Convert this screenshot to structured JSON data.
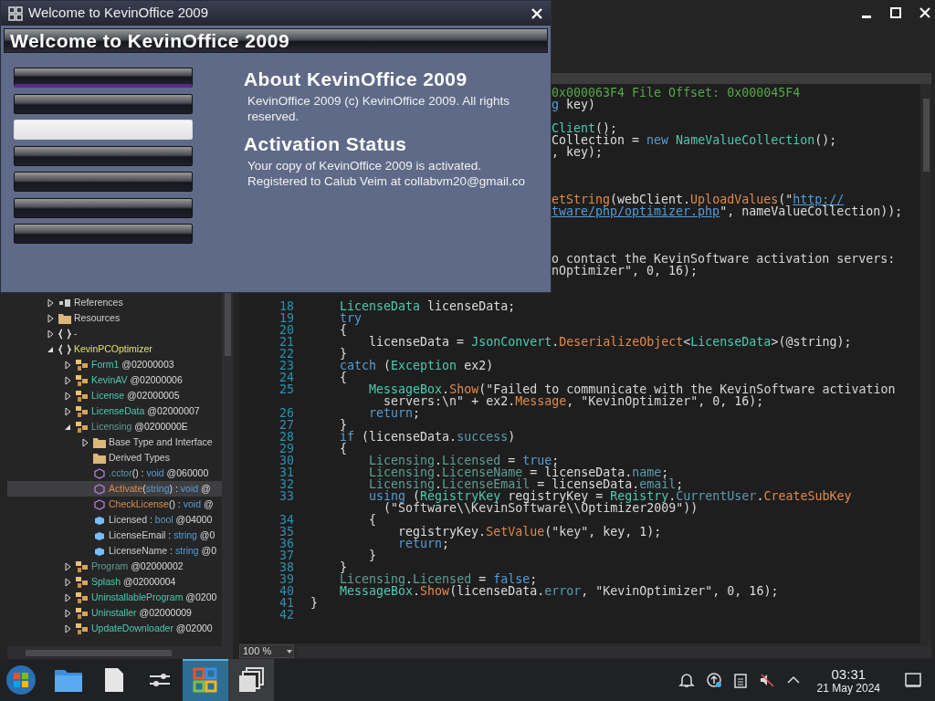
{
  "dialog": {
    "title": "Welcome to KevinOffice 2009",
    "banner": "Welcome to KevinOffice 2009",
    "menu_buttons": [
      {
        "selected": false,
        "focused": true
      },
      {
        "selected": false,
        "focused": false
      },
      {
        "selected": true,
        "focused": false
      },
      {
        "selected": false,
        "focused": false
      },
      {
        "selected": false,
        "focused": false
      },
      {
        "selected": false,
        "focused": false
      },
      {
        "selected": false,
        "focused": false
      }
    ],
    "sections": [
      {
        "heading": "About KevinOffice 2009",
        "lines": [
          "KevinOffice 2009 (c) KevinOffice 2009. All rights",
          "reserved."
        ]
      },
      {
        "heading": "Activation Status",
        "lines": [
          "Your copy of KevinOffice 2009 is activated.",
          "Registered to Calub Veim at collabvm20@gmail.co"
        ]
      }
    ]
  },
  "tree": [
    {
      "kind": "references",
      "expanded": false,
      "selected": false,
      "label": [
        {
          "kind": "field",
          "text": "References"
        }
      ]
    },
    {
      "kind": "folder",
      "expanded": false,
      "selected": false,
      "label": [
        {
          "kind": "field",
          "text": "Resources"
        }
      ]
    },
    {
      "kind": "namespace",
      "expanded": false,
      "selected": false,
      "label": [
        {
          "kind": "field",
          "text": "-"
        }
      ]
    },
    {
      "kind": "namespace",
      "expanded": true,
      "selected": false,
      "label": [
        {
          "kind": "ns",
          "text": "KevinPCOptimizer"
        }
      ],
      "children": [
        {
          "kind": "class",
          "expanded": false,
          "selected": false,
          "label": [
            {
              "kind": "type",
              "text": "Form1"
            },
            {
              "kind": "plain",
              "text": " @02000003"
            }
          ]
        },
        {
          "kind": "class",
          "expanded": false,
          "selected": false,
          "label": [
            {
              "kind": "type",
              "text": "KevinAV"
            },
            {
              "kind": "plain",
              "text": " @02000006"
            }
          ]
        },
        {
          "kind": "class",
          "expanded": false,
          "selected": false,
          "label": [
            {
              "kind": "type",
              "text": "License"
            },
            {
              "kind": "plain",
              "text": " @02000005"
            }
          ]
        },
        {
          "kind": "class",
          "expanded": false,
          "selected": false,
          "label": [
            {
              "kind": "type",
              "text": "LicenseData"
            },
            {
              "kind": "plain",
              "text": " @02000007"
            }
          ]
        },
        {
          "kind": "class",
          "expanded": true,
          "selected": false,
          "label": [
            {
              "kind": "type2",
              "text": "Licensing"
            },
            {
              "kind": "plain",
              "text": " @0200000E"
            }
          ],
          "children": [
            {
              "kind": "folder",
              "expanded": false,
              "selected": false,
              "label": [
                {
                  "kind": "field",
                  "text": "Base Type and Interface"
                }
              ]
            },
            {
              "kind": "folder",
              "selected": false,
              "label": [
                {
                  "kind": "field",
                  "text": "Derived Types"
                }
              ]
            },
            {
              "kind": "method",
              "selected": false,
              "label": [
                {
                  "kind": "prop",
                  "text": ".cctor"
                },
                {
                  "kind": "plain",
                  "text": "() : "
                },
                {
                  "kind": "keyword",
                  "text": "void"
                },
                {
                  "kind": "plain",
                  "text": " @060000"
                }
              ]
            },
            {
              "kind": "method",
              "selected": true,
              "label": [
                {
                  "kind": "method",
                  "text": "Activate"
                },
                {
                  "kind": "plain",
                  "text": "("
                },
                {
                  "kind": "keyword",
                  "text": "string"
                },
                {
                  "kind": "plain",
                  "text": ") : "
                },
                {
                  "kind": "keyword",
                  "text": "void"
                },
                {
                  "kind": "plain",
                  "text": " @"
                }
              ]
            },
            {
              "kind": "method",
              "selected": false,
              "label": [
                {
                  "kind": "method",
                  "text": "CheckLicense"
                },
                {
                  "kind": "plain",
                  "text": "() : "
                },
                {
                  "kind": "keyword",
                  "text": "void"
                },
                {
                  "kind": "plain",
                  "text": " @"
                }
              ]
            },
            {
              "kind": "field",
              "selected": false,
              "label": [
                {
                  "kind": "field",
                  "text": "Licensed"
                },
                {
                  "kind": "plain",
                  "text": " : "
                },
                {
                  "kind": "keyword",
                  "text": "bool"
                },
                {
                  "kind": "plain",
                  "text": " @04000"
                }
              ]
            },
            {
              "kind": "field",
              "selected": false,
              "label": [
                {
                  "kind": "field",
                  "text": "LicenseEmail"
                },
                {
                  "kind": "plain",
                  "text": " : "
                },
                {
                  "kind": "keyword",
                  "text": "string"
                },
                {
                  "kind": "plain",
                  "text": " @0"
                }
              ]
            },
            {
              "kind": "field",
              "selected": false,
              "label": [
                {
                  "kind": "field",
                  "text": "LicenseName"
                },
                {
                  "kind": "plain",
                  "text": " : "
                },
                {
                  "kind": "keyword",
                  "text": "string"
                },
                {
                  "kind": "plain",
                  "text": " @0"
                }
              ]
            }
          ]
        },
        {
          "kind": "class",
          "expanded": false,
          "selected": false,
          "label": [
            {
              "kind": "type2",
              "text": "Program"
            },
            {
              "kind": "plain",
              "text": " @02000002"
            }
          ]
        },
        {
          "kind": "class",
          "expanded": false,
          "selected": false,
          "label": [
            {
              "kind": "type",
              "text": "Splash"
            },
            {
              "kind": "plain",
              "text": " @02000004"
            }
          ]
        },
        {
          "kind": "class",
          "expanded": false,
          "selected": false,
          "label": [
            {
              "kind": "type",
              "text": "UninstallableProgram"
            },
            {
              "kind": "plain",
              "text": " @0200"
            }
          ]
        },
        {
          "kind": "class",
          "expanded": false,
          "selected": false,
          "label": [
            {
              "kind": "type",
              "text": "Uninstaller"
            },
            {
              "kind": "plain",
              "text": " @02000009"
            }
          ]
        },
        {
          "kind": "class",
          "expanded": false,
          "selected": false,
          "label": [
            {
              "kind": "type",
              "text": "UpdateDownloader"
            },
            {
              "kind": "plain",
              "text": " @02000"
            }
          ]
        }
      ]
    }
  ],
  "code": [
    {
      "kind": "fragment",
      "segs": [
        {
          "kind": "comment",
          "text": "0x000063F4 File Offset: 0x000045F4"
        }
      ]
    },
    {
      "kind": "fragment",
      "segs": [
        {
          "kind": "keyword",
          "text": "g"
        },
        {
          "kind": "plain",
          "text": " key)"
        }
      ]
    },
    {
      "kind": "blank"
    },
    {
      "kind": "fragment",
      "segs": [
        {
          "kind": "type",
          "text": "Client"
        },
        {
          "kind": "plain",
          "text": "();"
        }
      ]
    },
    {
      "kind": "fragment",
      "segs": [
        {
          "kind": "plain",
          "text": "Collection = "
        },
        {
          "kind": "keyword",
          "text": "new"
        },
        {
          "kind": "type",
          "text": " NameValueCollection"
        },
        {
          "kind": "plain",
          "text": "();"
        }
      ]
    },
    {
      "kind": "fragment",
      "segs": [
        {
          "kind": "plain",
          "text": ", key);"
        }
      ]
    },
    {
      "kind": "blank"
    },
    {
      "kind": "blank"
    },
    {
      "kind": "blank"
    },
    {
      "kind": "fragment",
      "segs": [
        {
          "kind": "method",
          "text": "etString"
        },
        {
          "kind": "plain",
          "text": "(webClient."
        },
        {
          "kind": "method",
          "text": "UploadValues"
        },
        {
          "kind": "plain",
          "text": "(\""
        },
        {
          "kind": "link",
          "text": "http://"
        }
      ]
    },
    {
      "kind": "fragment",
      "segs": [
        {
          "kind": "link",
          "text": "tware/php/optimizer.php"
        },
        {
          "kind": "plain",
          "text": "\", nameValueCollection));"
        }
      ]
    },
    {
      "kind": "blank"
    },
    {
      "kind": "blank"
    },
    {
      "kind": "blank"
    },
    {
      "kind": "fragment",
      "segs": [
        {
          "kind": "string",
          "text": "o contact the KevinSoftware activation servers:"
        }
      ]
    },
    {
      "kind": "fragment",
      "segs": [
        {
          "kind": "string",
          "text": "nOptimizer\""
        },
        {
          "kind": "plain",
          "text": ", 0, 16);"
        }
      ]
    },
    {
      "kind": "blank"
    },
    {
      "kind": "blank"
    },
    {
      "kind": "line",
      "n": "18",
      "segs": [
        {
          "kind": "type",
          "text": "    LicenseData"
        },
        {
          "kind": "plain",
          "text": " licenseData;"
        }
      ]
    },
    {
      "kind": "line",
      "n": "19",
      "segs": [
        {
          "kind": "keyword",
          "text": "    try"
        }
      ]
    },
    {
      "kind": "line",
      "n": "20",
      "segs": [
        {
          "kind": "plain",
          "text": "    {"
        }
      ]
    },
    {
      "kind": "line",
      "n": "21",
      "segs": [
        {
          "kind": "plain",
          "text": "        licenseData = "
        },
        {
          "kind": "type",
          "text": "JsonConvert"
        },
        {
          "kind": "plain",
          "text": "."
        },
        {
          "kind": "method",
          "text": "DeserializeObject"
        },
        {
          "kind": "plain",
          "text": "<"
        },
        {
          "kind": "type",
          "text": "LicenseData"
        },
        {
          "kind": "plain",
          "text": ">(@string);"
        }
      ]
    },
    {
      "kind": "line",
      "n": "22",
      "segs": [
        {
          "kind": "plain",
          "text": "    }"
        }
      ]
    },
    {
      "kind": "line",
      "n": "23",
      "segs": [
        {
          "kind": "keyword",
          "text": "    catch"
        },
        {
          "kind": "plain",
          "text": " ("
        },
        {
          "kind": "type",
          "text": "Exception"
        },
        {
          "kind": "plain",
          "text": " ex2)"
        }
      ]
    },
    {
      "kind": "line",
      "n": "24",
      "segs": [
        {
          "kind": "plain",
          "text": "    {"
        }
      ]
    },
    {
      "kind": "line",
      "n": "25",
      "segs": [
        {
          "kind": "type",
          "text": "        MessageBox"
        },
        {
          "kind": "plain",
          "text": "."
        },
        {
          "kind": "method",
          "text": "Show"
        },
        {
          "kind": "plain",
          "text": "("
        },
        {
          "kind": "string",
          "text": "\"Failed to communicate with the KevinSoftware activation"
        }
      ]
    },
    {
      "kind": "wrap",
      "segs": [
        {
          "kind": "string",
          "text": "          servers:\\n\""
        },
        {
          "kind": "plain",
          "text": " + ex2."
        },
        {
          "kind": "method",
          "text": "Message"
        },
        {
          "kind": "plain",
          "text": ", "
        },
        {
          "kind": "string",
          "text": "\"KevinOptimizer\""
        },
        {
          "kind": "plain",
          "text": ", 0, 16);"
        }
      ]
    },
    {
      "kind": "line",
      "n": "26",
      "segs": [
        {
          "kind": "keyword",
          "text": "        return"
        },
        {
          "kind": "plain",
          "text": ";"
        }
      ]
    },
    {
      "kind": "line",
      "n": "27",
      "segs": [
        {
          "kind": "plain",
          "text": "    }"
        }
      ]
    },
    {
      "kind": "line",
      "n": "28",
      "segs": [
        {
          "kind": "keyword",
          "text": "    if"
        },
        {
          "kind": "plain",
          "text": " (licenseData."
        },
        {
          "kind": "prop",
          "text": "success"
        },
        {
          "kind": "plain",
          "text": ")"
        }
      ]
    },
    {
      "kind": "line",
      "n": "29",
      "segs": [
        {
          "kind": "plain",
          "text": "    {"
        }
      ]
    },
    {
      "kind": "line",
      "n": "30",
      "segs": [
        {
          "kind": "type2",
          "text": "        Licensing"
        },
        {
          "kind": "plain",
          "text": "."
        },
        {
          "kind": "type2",
          "text": "Licensed"
        },
        {
          "kind": "plain",
          "text": " = "
        },
        {
          "kind": "keyword",
          "text": "true"
        },
        {
          "kind": "plain",
          "text": ";"
        }
      ]
    },
    {
      "kind": "line",
      "n": "31",
      "segs": [
        {
          "kind": "type2",
          "text": "        Licensing"
        },
        {
          "kind": "plain",
          "text": "."
        },
        {
          "kind": "type2",
          "text": "LicenseName"
        },
        {
          "kind": "plain",
          "text": " = licenseData."
        },
        {
          "kind": "prop",
          "text": "name"
        },
        {
          "kind": "plain",
          "text": ";"
        }
      ]
    },
    {
      "kind": "line",
      "n": "32",
      "segs": [
        {
          "kind": "type2",
          "text": "        Licensing"
        },
        {
          "kind": "plain",
          "text": "."
        },
        {
          "kind": "type2",
          "text": "LicenseEmail"
        },
        {
          "kind": "plain",
          "text": " = licenseData."
        },
        {
          "kind": "prop",
          "text": "email"
        },
        {
          "kind": "plain",
          "text": ";"
        }
      ]
    },
    {
      "kind": "line",
      "n": "33",
      "segs": [
        {
          "kind": "keyword",
          "text": "        using"
        },
        {
          "kind": "plain",
          "text": " ("
        },
        {
          "kind": "type",
          "text": "RegistryKey"
        },
        {
          "kind": "plain",
          "text": " registryKey = "
        },
        {
          "kind": "type",
          "text": "Registry"
        },
        {
          "kind": "plain",
          "text": "."
        },
        {
          "kind": "prop",
          "text": "CurrentUser"
        },
        {
          "kind": "plain",
          "text": "."
        },
        {
          "kind": "method",
          "text": "CreateSubKey"
        }
      ]
    },
    {
      "kind": "wrap",
      "segs": [
        {
          "kind": "plain",
          "text": "          ("
        },
        {
          "kind": "string",
          "text": "\"Software\\\\KevinSoftware\\\\Optimizer2009\""
        },
        {
          "kind": "plain",
          "text": "))"
        }
      ]
    },
    {
      "kind": "line",
      "n": "34",
      "segs": [
        {
          "kind": "plain",
          "text": "        {"
        }
      ]
    },
    {
      "kind": "line",
      "n": "35",
      "segs": [
        {
          "kind": "plain",
          "text": "            registryKey."
        },
        {
          "kind": "method",
          "text": "SetValue"
        },
        {
          "kind": "plain",
          "text": "("
        },
        {
          "kind": "string",
          "text": "\"key\""
        },
        {
          "kind": "plain",
          "text": ", key, 1);"
        }
      ]
    },
    {
      "kind": "line",
      "n": "36",
      "segs": [
        {
          "kind": "keyword",
          "text": "            return"
        },
        {
          "kind": "plain",
          "text": ";"
        }
      ]
    },
    {
      "kind": "line",
      "n": "37",
      "segs": [
        {
          "kind": "plain",
          "text": "        }"
        }
      ]
    },
    {
      "kind": "line",
      "n": "38",
      "segs": [
        {
          "kind": "plain",
          "text": "    }"
        }
      ]
    },
    {
      "kind": "line",
      "n": "39",
      "segs": [
        {
          "kind": "type2",
          "text": "    Licensing"
        },
        {
          "kind": "plain",
          "text": "."
        },
        {
          "kind": "type2",
          "text": "Licensed"
        },
        {
          "kind": "plain",
          "text": " = "
        },
        {
          "kind": "keyword",
          "text": "false"
        },
        {
          "kind": "plain",
          "text": ";"
        }
      ]
    },
    {
      "kind": "line",
      "n": "40",
      "segs": [
        {
          "kind": "type",
          "text": "    MessageBox"
        },
        {
          "kind": "plain",
          "text": "."
        },
        {
          "kind": "method",
          "text": "Show"
        },
        {
          "kind": "plain",
          "text": "(licenseData."
        },
        {
          "kind": "prop",
          "text": "error"
        },
        {
          "kind": "plain",
          "text": ", "
        },
        {
          "kind": "string",
          "text": "\"KevinOptimizer\""
        },
        {
          "kind": "plain",
          "text": ", 0, 16);"
        }
      ]
    },
    {
      "kind": "line",
      "n": "41",
      "segs": [
        {
          "kind": "plain",
          "text": "}"
        }
      ]
    },
    {
      "kind": "line",
      "n": "42"
    }
  ],
  "zoom": "100 %",
  "taskbar": {
    "apps": [
      {
        "selected": false
      },
      {
        "selected": false
      },
      {
        "selected": false
      },
      {
        "selected": true
      },
      {
        "selected": false
      }
    ],
    "time": "03:31",
    "date": "21 May 2024"
  }
}
